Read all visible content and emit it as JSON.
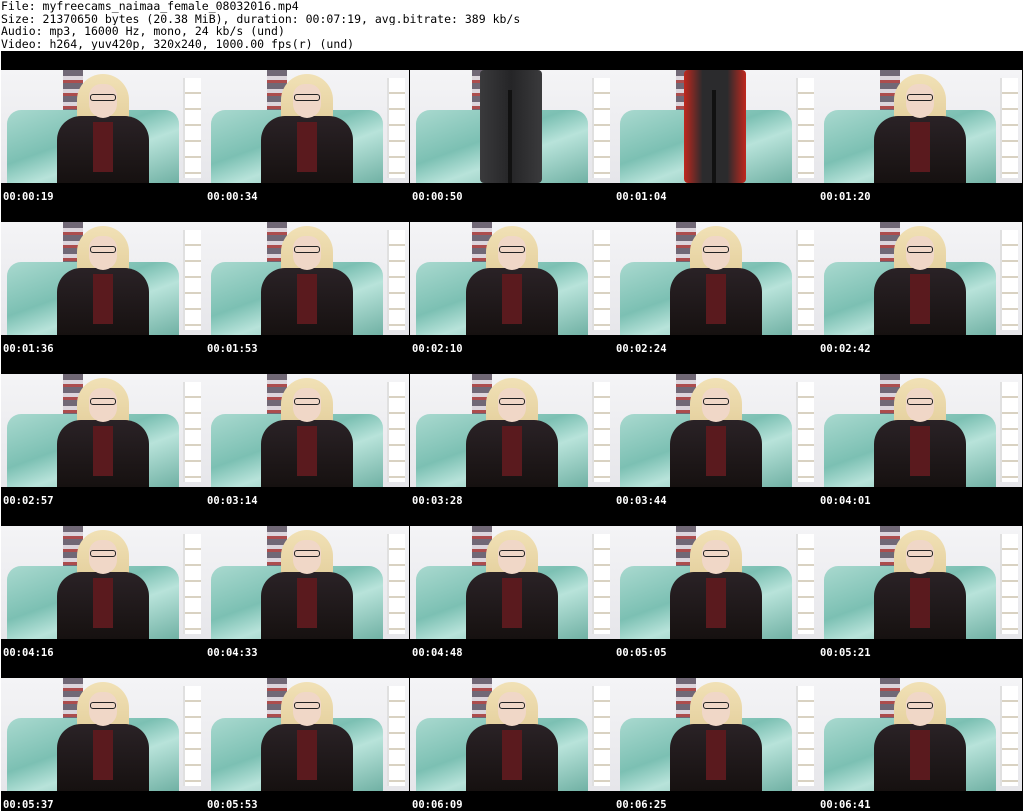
{
  "header": {
    "file_line": "File: myfreecams_naimaa_female_08032016.mp4",
    "size_line": "Size: 21370650 bytes (20.38 MiB), duration: 00:07:19, avg.bitrate: 389 kb/s",
    "audio_line": "Audio: mp3, 16000 Hz, mono, 24 kb/s (und)",
    "video_line": "Video: h264, yuv420p, 320x240, 1000.00 fps(r) (und)"
  },
  "rows": [
    {
      "frames": [
        {
          "timestamp": "00:00:19",
          "scene": "seated"
        },
        {
          "timestamp": "00:00:34",
          "scene": "seated"
        },
        {
          "timestamp": "00:00:50",
          "scene": "legs"
        },
        {
          "timestamp": "00:01:04",
          "scene": "legs-redcoat"
        },
        {
          "timestamp": "00:01:20",
          "scene": "seated"
        }
      ]
    },
    {
      "frames": [
        {
          "timestamp": "00:01:36",
          "scene": "seated"
        },
        {
          "timestamp": "00:01:53",
          "scene": "seated"
        },
        {
          "timestamp": "00:02:10",
          "scene": "seated"
        },
        {
          "timestamp": "00:02:24",
          "scene": "seated"
        },
        {
          "timestamp": "00:02:42",
          "scene": "seated"
        }
      ]
    },
    {
      "frames": [
        {
          "timestamp": "00:02:57",
          "scene": "seated"
        },
        {
          "timestamp": "00:03:14",
          "scene": "seated"
        },
        {
          "timestamp": "00:03:28",
          "scene": "seated"
        },
        {
          "timestamp": "00:03:44",
          "scene": "seated"
        },
        {
          "timestamp": "00:04:01",
          "scene": "seated"
        }
      ]
    },
    {
      "frames": [
        {
          "timestamp": "00:04:16",
          "scene": "seated"
        },
        {
          "timestamp": "00:04:33",
          "scene": "seated"
        },
        {
          "timestamp": "00:04:48",
          "scene": "seated"
        },
        {
          "timestamp": "00:05:05",
          "scene": "seated"
        },
        {
          "timestamp": "00:05:21",
          "scene": "seated"
        }
      ]
    },
    {
      "frames": [
        {
          "timestamp": "00:05:37",
          "scene": "seated"
        },
        {
          "timestamp": "00:05:53",
          "scene": "seated"
        },
        {
          "timestamp": "00:06:09",
          "scene": "seated"
        },
        {
          "timestamp": "00:06:25",
          "scene": "seated"
        },
        {
          "timestamp": "00:06:41",
          "scene": "seated"
        }
      ]
    }
  ]
}
